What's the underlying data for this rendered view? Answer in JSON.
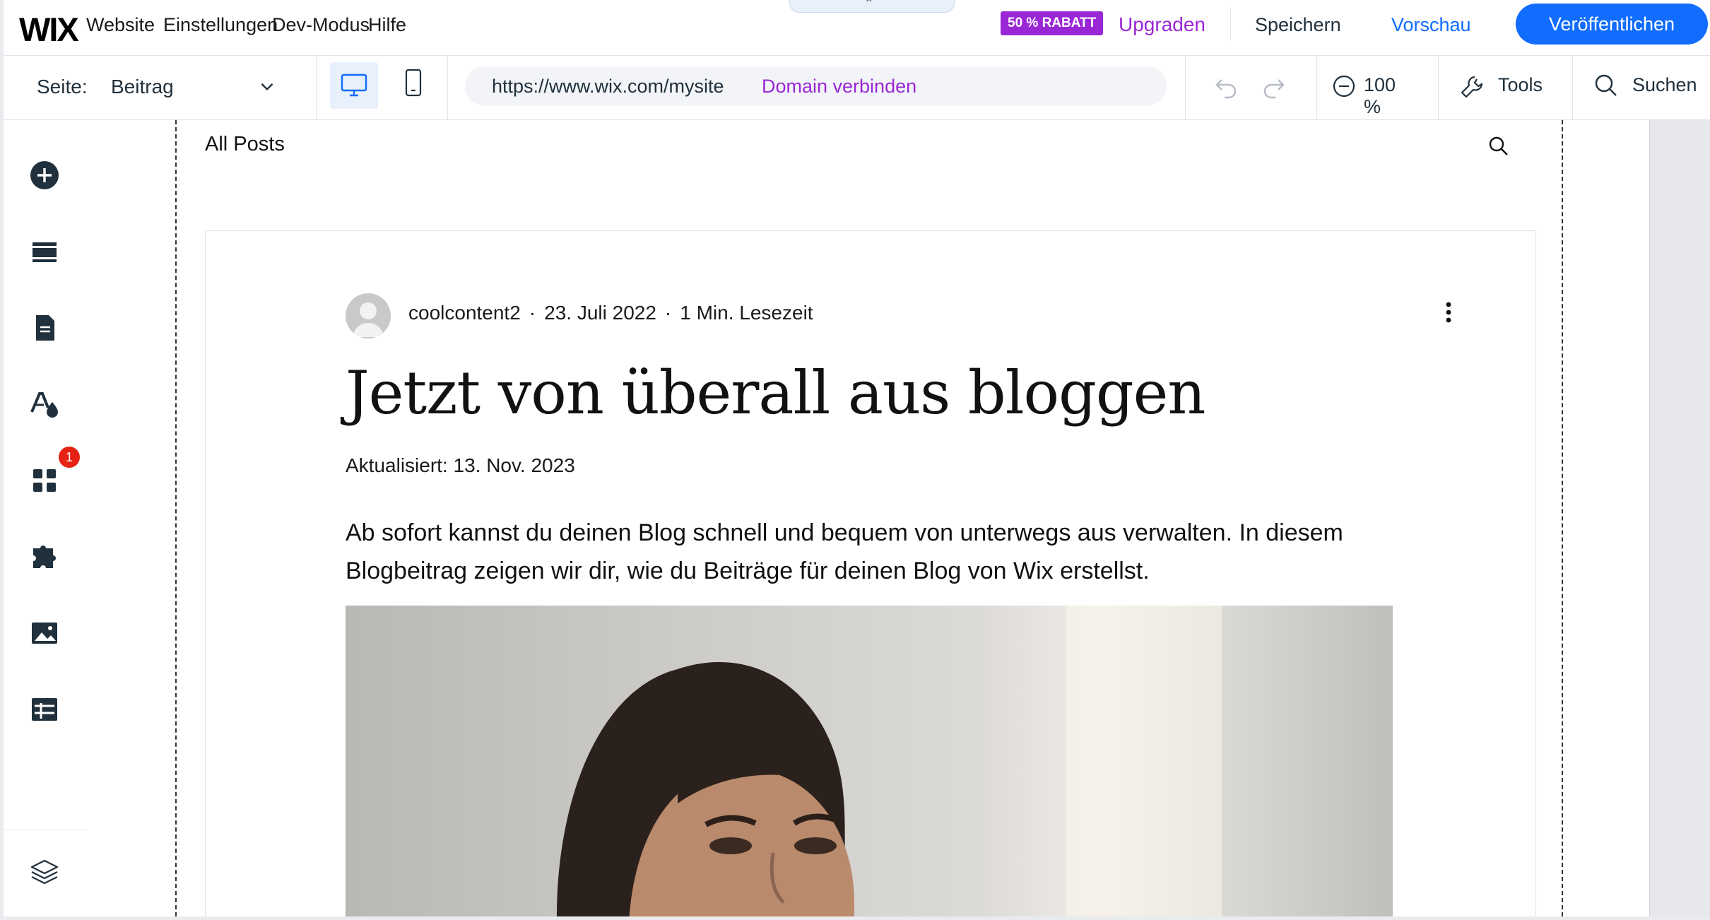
{
  "topbar": {
    "logo": "WIX",
    "menu": [
      "Website",
      "Einstellungen",
      "Dev-Modus",
      "Hilfe"
    ],
    "handle_icon": "close-icon",
    "promo_badge": "50 % RABATT",
    "upgrade_label": "Upgraden",
    "save_label": "Speichern",
    "preview_label": "Vorschau",
    "publish_label": "Veröffentlichen"
  },
  "toolbar": {
    "page_label": "Seite:",
    "page_value": "Beitrag",
    "url": "https://www.wix.com/mysite",
    "domain_link": "Domain verbinden",
    "zoom": "100 %",
    "tools_label": "Tools",
    "search_label": "Suchen"
  },
  "sidebar": {
    "items": [
      {
        "name": "add-elements",
        "icon": "plus-circle-icon"
      },
      {
        "name": "sections",
        "icon": "sections-icon"
      },
      {
        "name": "pages",
        "icon": "page-icon"
      },
      {
        "name": "design",
        "icon": "theme-icon"
      },
      {
        "name": "apps",
        "icon": "apps-grid-icon"
      },
      {
        "name": "business-tools",
        "icon": "puzzle-icon"
      },
      {
        "name": "media",
        "icon": "image-icon"
      },
      {
        "name": "cms",
        "icon": "table-icon"
      },
      {
        "name": "layers",
        "icon": "layers-icon"
      }
    ],
    "apps_badge": "1"
  },
  "blog": {
    "nav_label": "All Posts",
    "author": "coolcontent2",
    "date": "23. Juli 2022",
    "read_time": "1 Min. Lesezeit",
    "separator": "·",
    "title": "Jetzt von überall aus bloggen",
    "updated": "Aktualisiert: 13. Nov. 2023",
    "excerpt": "Ab sofort kannst du deinen Blog schnell und bequem von unterwegs aus verwalten. In diesem Blogbeitrag zeigen wir dir, wie du Beiträge für deinen Blog von Wix erstellst."
  },
  "colors": {
    "accent_blue": "#116dff",
    "premium_purple": "#9a27d5",
    "badge_red": "#e62214"
  }
}
